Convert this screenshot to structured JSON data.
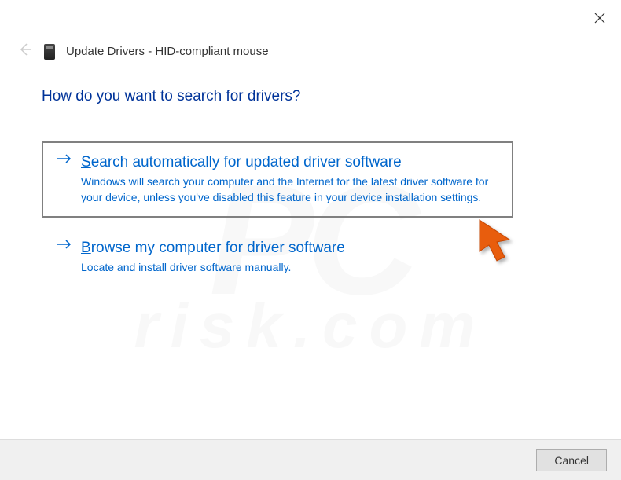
{
  "window": {
    "title": "Update Drivers - HID-compliant mouse"
  },
  "heading": "How do you want to search for drivers?",
  "options": {
    "auto": {
      "accel": "S",
      "title_rest": "earch automatically for updated driver software",
      "desc": "Windows will search your computer and the Internet for the latest driver software for your device, unless you've disabled this feature in your device installation settings."
    },
    "browse": {
      "accel": "B",
      "title_rest": "rowse my computer for driver software",
      "desc": "Locate and install driver software manually."
    }
  },
  "buttons": {
    "cancel": "Cancel"
  },
  "colors": {
    "link_blue": "#0066cc",
    "heading_blue": "#003399",
    "cursor_orange": "#e85d0f"
  },
  "watermark": {
    "main": "PC",
    "sub": "risk.com"
  }
}
